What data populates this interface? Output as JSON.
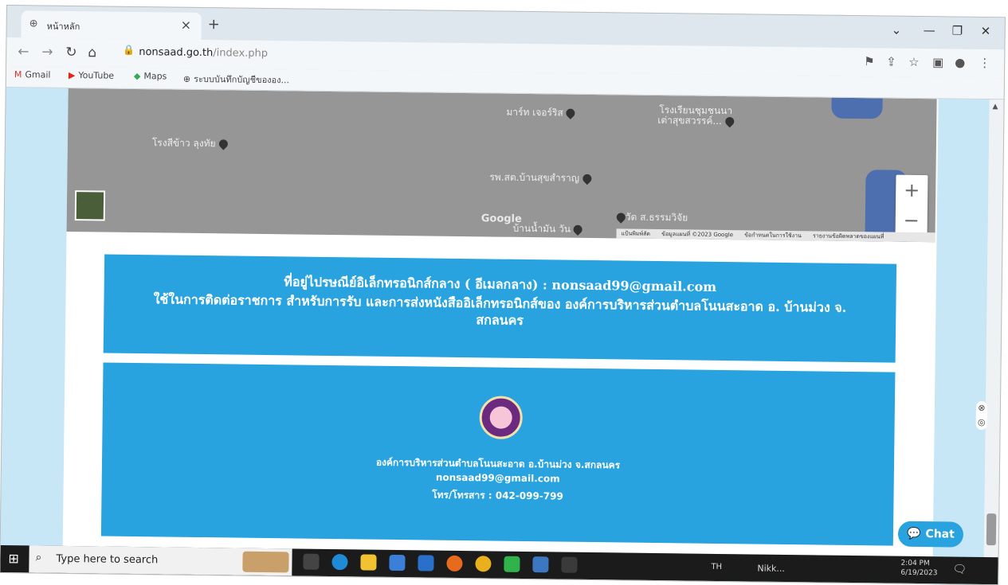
{
  "browser": {
    "tab_title": "หน้าหลัก",
    "tab_close": "×",
    "new_tab": "+",
    "address_domain": "nonsaad.go.th",
    "address_path": "/index.php",
    "bookmarks": [
      {
        "label": "Gmail",
        "icon": "gmail-icon"
      },
      {
        "label": "YouTube",
        "icon": "youtube-icon"
      },
      {
        "label": "Maps",
        "icon": "maps-icon"
      },
      {
        "label": "ระบบบันทึกบัญชีขององ...",
        "icon": "globe-icon"
      }
    ]
  },
  "map": {
    "labels": [
      {
        "text": "มาร์ท เจอร์ริส"
      },
      {
        "text": "โรงเรียนชุมชนนา"
      },
      {
        "text": "เต่าสุขสวรรค์..."
      },
      {
        "text": "โรงสีข้าว ลุงทัย"
      },
      {
        "text": "รพ.สต.บ้านสุขสำราญ"
      },
      {
        "text": "วัด ส.ธรรมวิจัย"
      },
      {
        "text": "บ้านน้ำมัน วัน"
      }
    ],
    "google": "Google",
    "zoom_in": "+",
    "zoom_out": "−",
    "attribution": [
      "แป้นพิมพ์ลัด",
      "ข้อมูลแผนที่ ©2023 Google",
      "ข้อกำหนดในการใช้งาน",
      "รายงานข้อผิดพลาดของแผนที่"
    ]
  },
  "address_box": {
    "line1_prefix": "ที่อยู่ไปรษณีย์อิเล็กทรอนิกส์กลาง ( อีเมลกลาง) : ",
    "line1_email": "nonsaad99@gmail.com",
    "line2": "ใช้ในการติดต่อราชการ สำหรับการรับ และการส่งหนังสืออิเล็กทรอนิกส์ของ องค์การบริหารส่วนตำบลโนนสะอาด อ. บ้านม่วง จ. สกลนคร"
  },
  "footer": {
    "org_name": "องค์การบริหารส่วนตำบลโนนสะอาด อ.บ้านม่วง จ.สกลนคร",
    "email": "nonsaad99@gmail.com",
    "phone": "โทร/โทรสาร : 042-099-799"
  },
  "chat": {
    "label": "Chat"
  },
  "taskbar": {
    "search_placeholder": "Type here to search",
    "language": "TH",
    "app_label": "Nikk...",
    "time": "2:04 PM",
    "date": "6/19/2023"
  },
  "colors": {
    "accent": "#29a3e0",
    "page_bg": "#c7e7f6",
    "map": "#969696"
  }
}
